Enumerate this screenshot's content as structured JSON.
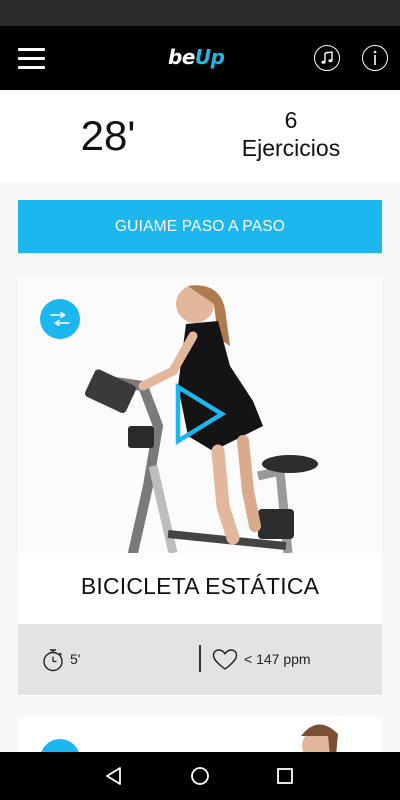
{
  "app": {
    "logo_part1": "be",
    "logo_part2": "Up"
  },
  "summary": {
    "duration": "28'",
    "exercise_count": "6",
    "exercise_label": "Ejercicios"
  },
  "guide_button": {
    "label": "GUIAME PASO A PASO"
  },
  "exercise_card": {
    "title": "BICICLETA ESTÁTICA",
    "duration": "5'",
    "heart_rate": "< 147 ppm"
  },
  "colors": {
    "accent": "#1cb7ef",
    "appbar": "#000000",
    "info_bar": "#e3e3e3"
  },
  "icons": {
    "menu": "hamburger-menu-icon",
    "music": "music-note-icon",
    "info": "info-icon",
    "shuffle": "shuffle-icon",
    "play": "play-icon",
    "timer": "stopwatch-icon",
    "heart": "heart-icon",
    "nav_back": "triangle-back-icon",
    "nav_home": "circle-home-icon",
    "nav_recent": "square-recent-icon"
  }
}
